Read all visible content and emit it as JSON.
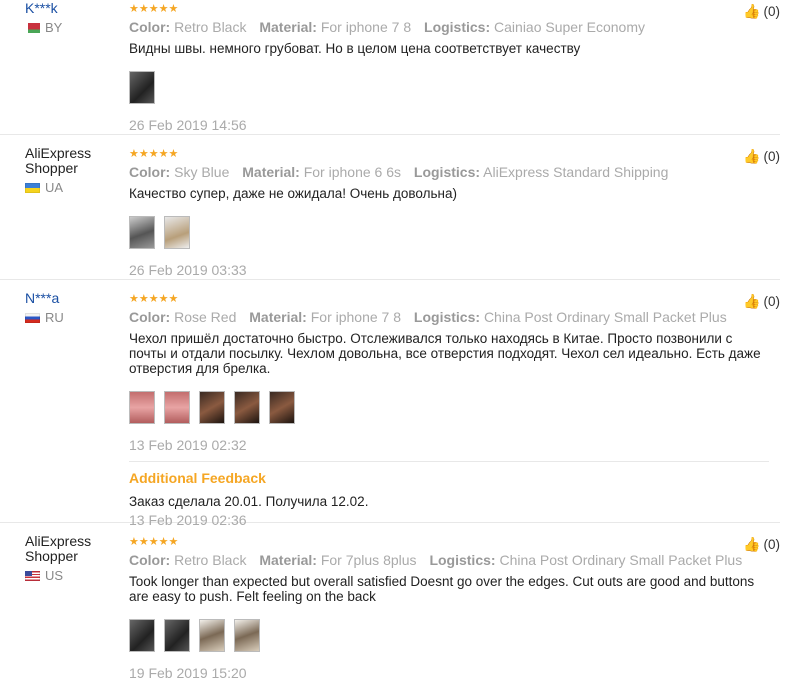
{
  "reviews": [
    {
      "user": "K***k",
      "country": "BY",
      "stars": "★★★★★",
      "color_label": "Color:",
      "color": "Retro Black",
      "material_label": "Material:",
      "material": "For iphone 7 8",
      "logistics_label": "Logistics:",
      "logistics": "Cainiao Super Economy",
      "text": "Видны швы. немного грубоват. Но в целом цена соответствует качеству",
      "date": "26 Feb 2019 14:56",
      "likes": "(0)"
    },
    {
      "user": "AliExpress Shopper",
      "country": "UA",
      "stars": "★★★★★",
      "color_label": "Color:",
      "color": "Sky Blue",
      "material_label": "Material:",
      "material": "For iphone 6 6s",
      "logistics_label": "Logistics:",
      "logistics": "AliExpress Standard Shipping",
      "text": "Качество супер, даже не ожидала! Очень довольна)",
      "date": "26 Feb 2019 03:33",
      "likes": "(0)"
    },
    {
      "user": "N***a",
      "country": "RU",
      "stars": "★★★★★",
      "color_label": "Color:",
      "color": "Rose Red",
      "material_label": "Material:",
      "material": "For iphone 7 8",
      "logistics_label": "Logistics:",
      "logistics": "China Post Ordinary Small Packet Plus",
      "text": "Чехол пришёл достаточно быстро. Отслеживался только находясь в Китае. Просто позвонили с почты и отдали посылку. Чехлом довольна, все отверстия подходят. Чехол сел идеально. Есть даже отверстия для брелка.",
      "date": "13 Feb 2019 02:32",
      "likes": "(0)",
      "feedback_title": "Additional Feedback",
      "feedback_text": "Заказ сделала 20.01. Получила 12.02.",
      "feedback_date": "13 Feb 2019 02:36"
    },
    {
      "user": "AliExpress Shopper",
      "country": "US",
      "stars": "★★★★★",
      "color_label": "Color:",
      "color": "Retro Black",
      "material_label": "Material:",
      "material": "For 7plus 8plus",
      "logistics_label": "Logistics:",
      "logistics": "China Post Ordinary Small Packet Plus",
      "text": "Took longer than expected but overall satisfied Doesnt go over the edges. Cut outs are good and buttons are easy to push. Felt feeling on the back",
      "date": "19 Feb 2019 15:20",
      "likes": "(0)"
    }
  ],
  "icons": {
    "like": "thumbs-up-icon"
  },
  "colors": {
    "accent": "#f5a623",
    "link": "#1a4fa3"
  }
}
